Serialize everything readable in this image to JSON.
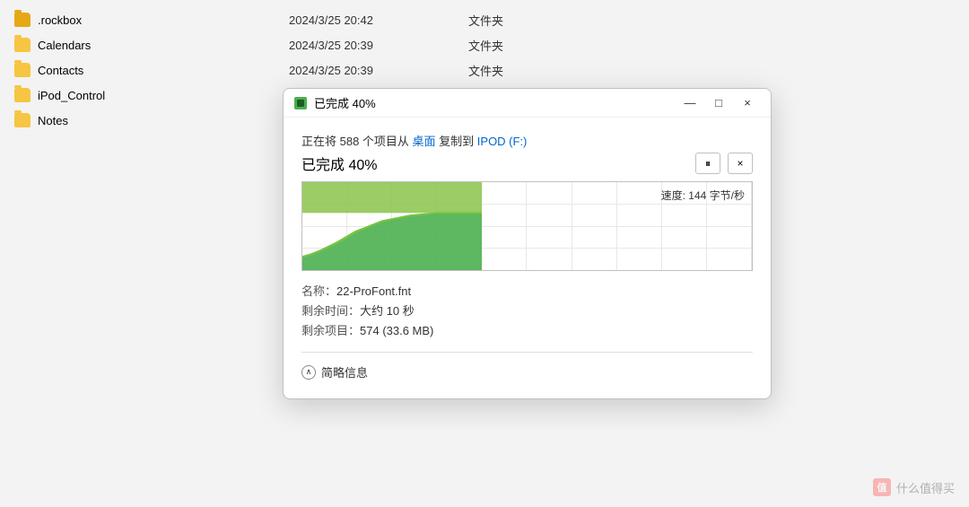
{
  "fileList": {
    "items": [
      {
        "name": ".rockbox",
        "date": "2024/3/25 20:42",
        "type": "文件夹",
        "icon": "folder"
      },
      {
        "name": "Calendars",
        "date": "2024/3/25 20:39",
        "type": "文件夹",
        "icon": "folder"
      },
      {
        "name": "Contacts",
        "date": "2024/3/25 20:39",
        "type": "文件夹",
        "icon": "folder"
      },
      {
        "name": "iPod_Control",
        "date": "2024/3/25 20:39",
        "type": "文件夹",
        "icon": "folder"
      },
      {
        "name": "Notes",
        "date": "",
        "type": "",
        "icon": "folder"
      }
    ]
  },
  "dialog": {
    "titlebar": {
      "title": "已完成 40%",
      "minimize_label": "—",
      "maximize_label": "□",
      "close_label": "×"
    },
    "body": {
      "copy_desc_prefix": "正在将 588 个项目从 ",
      "copy_source": "桌面",
      "copy_desc_mid": " 复制到 ",
      "copy_dest": "IPOD (F:)",
      "progress_title": "已完成 40%",
      "speed_label": "速度: 144 字节/秒",
      "file_name_label": "名称：",
      "file_name_value": "22-ProFont.fnt",
      "remaining_time_label": "剩余时间：",
      "remaining_time_value": "大约 10 秒",
      "remaining_items_label": "剩余项目：",
      "remaining_items_value": "574 (33.6 MB)",
      "collapse_label": "简略信息"
    },
    "controls": {
      "pause_label": "⏸",
      "cancel_label": "×"
    }
  },
  "watermark": {
    "icon": "值",
    "text": "什么值得买"
  }
}
